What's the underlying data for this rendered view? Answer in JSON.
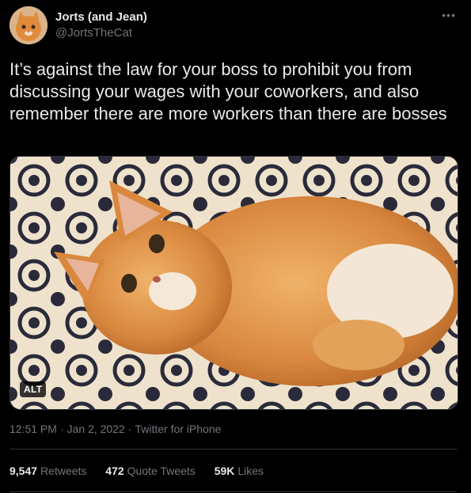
{
  "author": {
    "display_name": "Jorts (and Jean)",
    "handle": "@JortsTheCat",
    "avatar_icon": "cat-avatar"
  },
  "more_icon": "more-options-icon",
  "tweet": {
    "text": "It’s against the law for your boss to prohibit you from discussing your wages with your coworkers, and also remember there are more workers than there are bosses"
  },
  "media": {
    "alt_badge": "ALT",
    "subject": "orange-cat-photo"
  },
  "meta": {
    "time": "12:51 PM",
    "separator": "·",
    "date": "Jan 2, 2022",
    "source": "Twitter for iPhone"
  },
  "stats": {
    "retweets_count": "9,547",
    "retweets_label": "Retweets",
    "quotes_count": "472",
    "quotes_label": "Quote Tweets",
    "likes_count": "59K",
    "likes_label": "Likes"
  },
  "colors": {
    "background": "#000000",
    "text": "#e7e9ea",
    "muted": "#71767b",
    "divider": "#2f3336"
  }
}
